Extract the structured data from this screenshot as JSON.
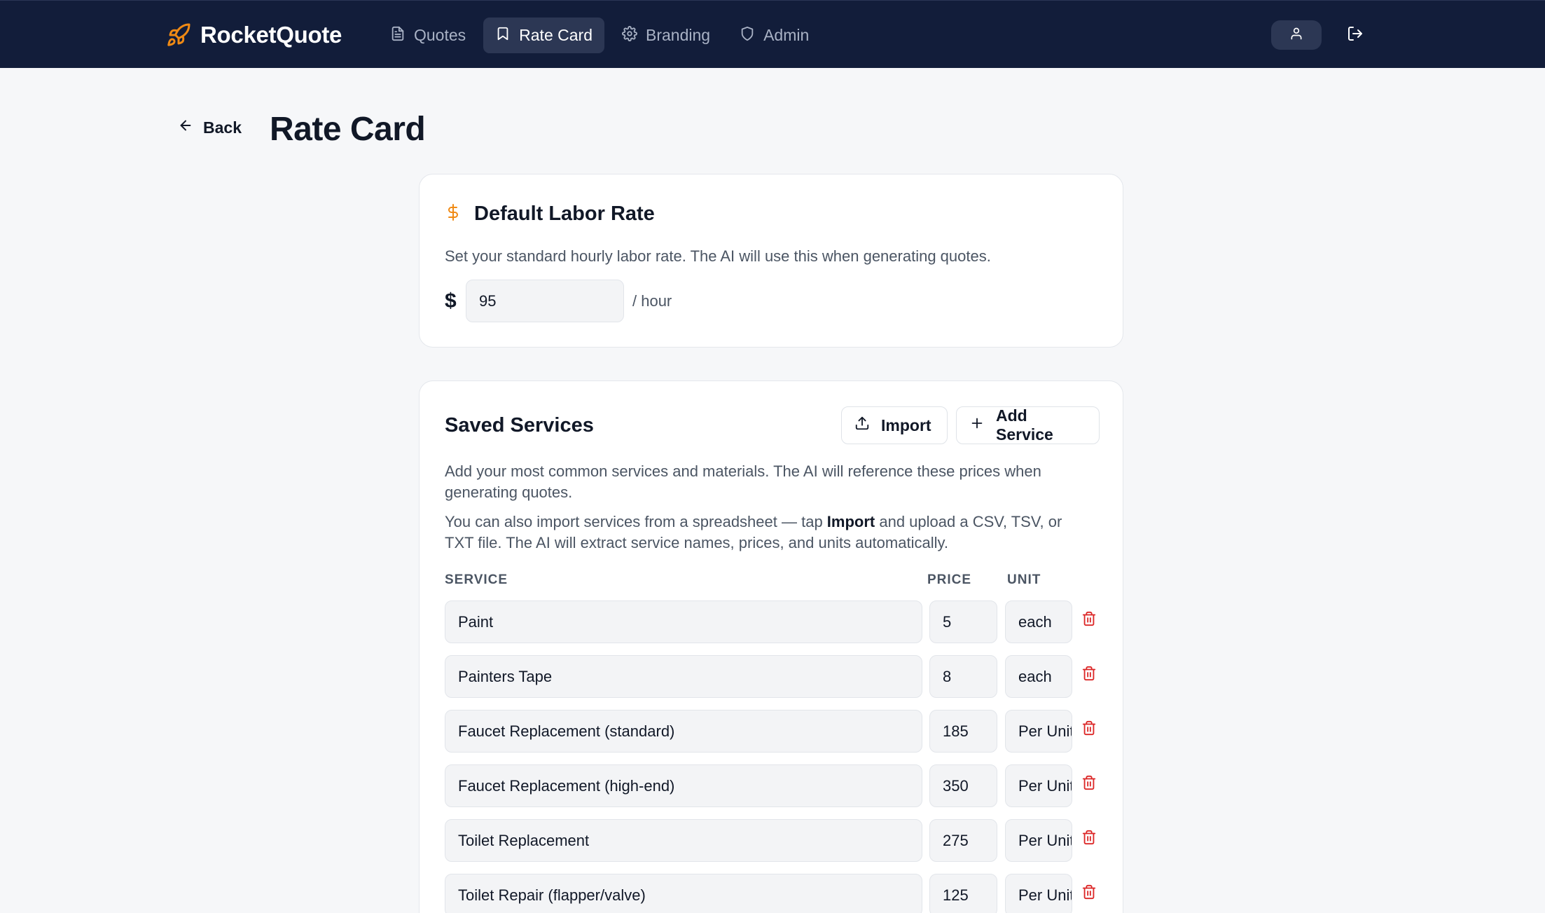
{
  "app": {
    "name": "RocketQuote",
    "brand_color": "#f08a14",
    "nav_bg": "#121d3a"
  },
  "nav": {
    "items": [
      {
        "label": "Quotes",
        "icon": "document-icon",
        "active": false
      },
      {
        "label": "Rate Card",
        "icon": "bookmark-icon",
        "active": true
      },
      {
        "label": "Branding",
        "icon": "gear-icon",
        "active": false
      },
      {
        "label": "Admin",
        "icon": "shield-icon",
        "active": false
      }
    ],
    "user_icon": "user-icon",
    "logout_icon": "logout-icon"
  },
  "header": {
    "back_label": "Back",
    "title": "Rate Card"
  },
  "labor": {
    "title": "Default Labor Rate",
    "icon": "dollar-icon",
    "description": "Set your standard hourly labor rate. The AI will use this when generating quotes.",
    "currency": "$",
    "rate": "95",
    "unit": "/ hour"
  },
  "services": {
    "title": "Saved Services",
    "import_label": "Import",
    "add_label": "Add Service",
    "description": "Add your most common services and materials. The AI will reference these prices when generating quotes.",
    "import_note_prefix": "You can also import services from a spreadsheet — tap ",
    "import_note_bold": "Import",
    "import_note_suffix": " and upload a CSV, TSV, or TXT file. The AI will extract service names, prices, and units automatically.",
    "columns": {
      "service": "SERVICE",
      "price": "PRICE",
      "unit": "UNIT"
    },
    "rows": [
      {
        "name": "Paint",
        "price": "5",
        "unit": "each"
      },
      {
        "name": "Painters Tape",
        "price": "8",
        "unit": "each"
      },
      {
        "name": "Faucet Replacement (standard)",
        "price": "185",
        "unit": "Per Unit"
      },
      {
        "name": "Faucet Replacement (high-end)",
        "price": "350",
        "unit": "Per Unit"
      },
      {
        "name": "Toilet Replacement",
        "price": "275",
        "unit": "Per Unit"
      },
      {
        "name": "Toilet Repair (flapper/valve)",
        "price": "125",
        "unit": "Per Unit"
      }
    ],
    "delete_color": "#dc2626"
  }
}
